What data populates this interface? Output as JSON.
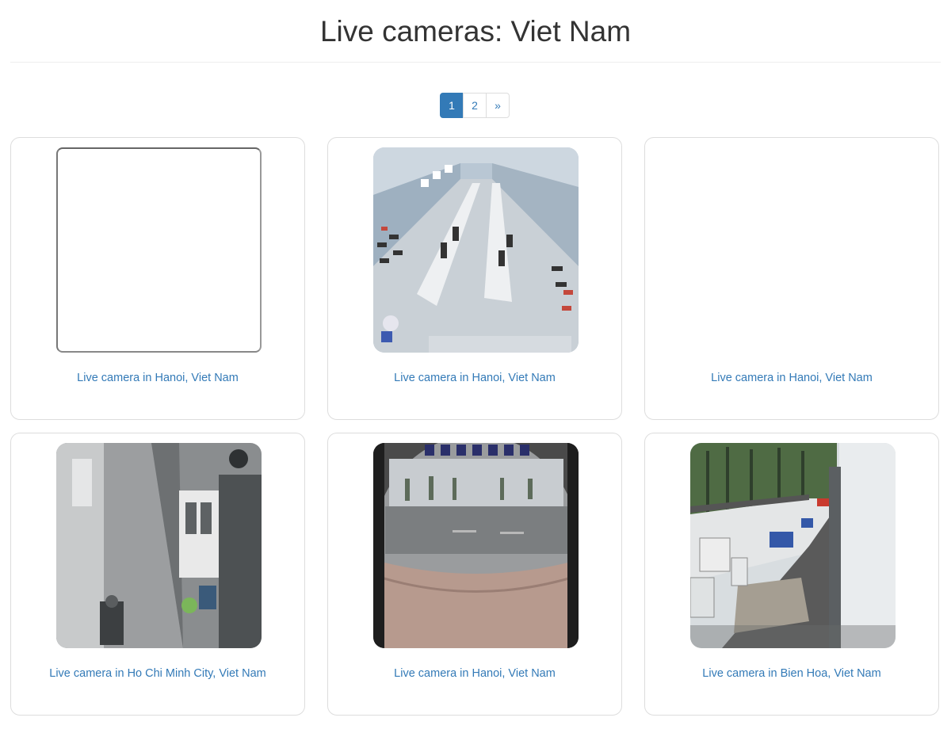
{
  "page": {
    "title": "Live cameras: Viet Nam"
  },
  "pagination": {
    "pages": [
      "1",
      "2"
    ],
    "active": "1",
    "next_label": "»"
  },
  "cameras": [
    {
      "caption": "Live camera in Hanoi, Viet Nam",
      "thumb": "blank-frame"
    },
    {
      "caption": "Live camera in Hanoi, Viet Nam",
      "thumb": "shoe-store-interior"
    },
    {
      "caption": "Live camera in Hanoi, Viet Nam",
      "thumb": "blank"
    },
    {
      "caption": "Live camera in Ho Chi Minh City, Viet Nam",
      "thumb": "house-alley"
    },
    {
      "caption": "Live camera in Hanoi, Viet Nam",
      "thumb": "street-fisheye"
    },
    {
      "caption": "Live camera in Bien Hoa, Viet Nam",
      "thumb": "factory-yard"
    }
  ],
  "colors": {
    "link": "#337ab7",
    "active_page_bg": "#337ab7",
    "border": "#dddddd"
  }
}
